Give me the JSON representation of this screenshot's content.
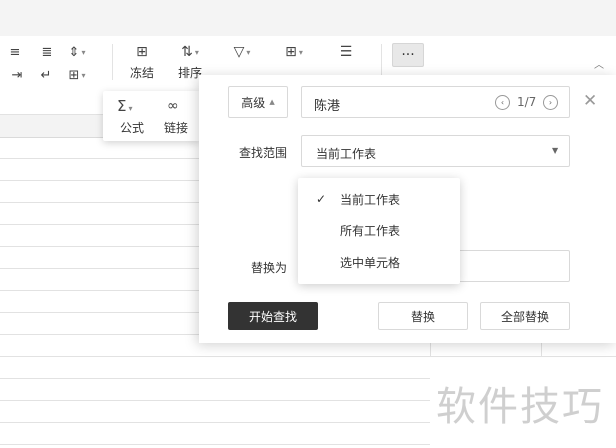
{
  "toolbar": {
    "freeze_label": "冻结",
    "sort_label": "排序",
    "filter_label": "筛选",
    "more_label": "···",
    "collapse_label": "︿"
  },
  "popup_tools": {
    "formula_label": "公式",
    "link_label": "链接"
  },
  "find_dialog": {
    "advanced_button": "高级",
    "search_value": "陈港",
    "match_counter": "1/7",
    "scope_label": "查找范围",
    "scope_selected": "当前工作表",
    "scope_options": [
      "当前工作表",
      "所有工作表",
      "选中单元格"
    ],
    "replace_label": "替换为",
    "replace_value": "",
    "start_find_button": "开始查找",
    "replace_button": "替换",
    "replace_all_button": "全部替换"
  },
  "watermark": "软件技巧",
  "colors": {
    "dark_button": "#333333",
    "border": "#d9d9d9"
  }
}
